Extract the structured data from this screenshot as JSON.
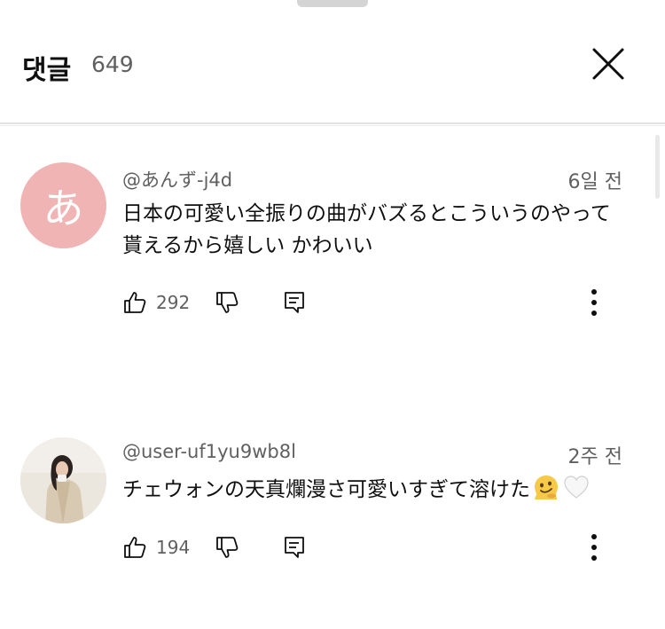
{
  "header": {
    "title": "댓글",
    "count": "649"
  },
  "icons": {
    "close": "close-icon",
    "like": "thumbs-up-icon",
    "dislike": "thumbs-down-icon",
    "reply": "reply-icon",
    "more": "more-vertical-icon"
  },
  "colors": {
    "avatar_pink": "#f1b4b4",
    "secondary_text": "#606060",
    "primary_text": "#0f0f0f"
  },
  "comments": [
    {
      "avatar_char": "あ",
      "author": "@あんず-j4d",
      "time": "6일 전",
      "text": "日本の可愛い全振りの曲がバズるとこういうのやって貰えるから嬉しい かわいい",
      "likes": "292"
    },
    {
      "author": "@user-uf1yu9wb8l",
      "time": "2주 전",
      "text": "チェウォンの天真爛漫さ可愛いすぎて溶けた",
      "emojis": [
        "melting-face-emoji",
        "white-heart-emoji"
      ],
      "likes": "194"
    }
  ]
}
